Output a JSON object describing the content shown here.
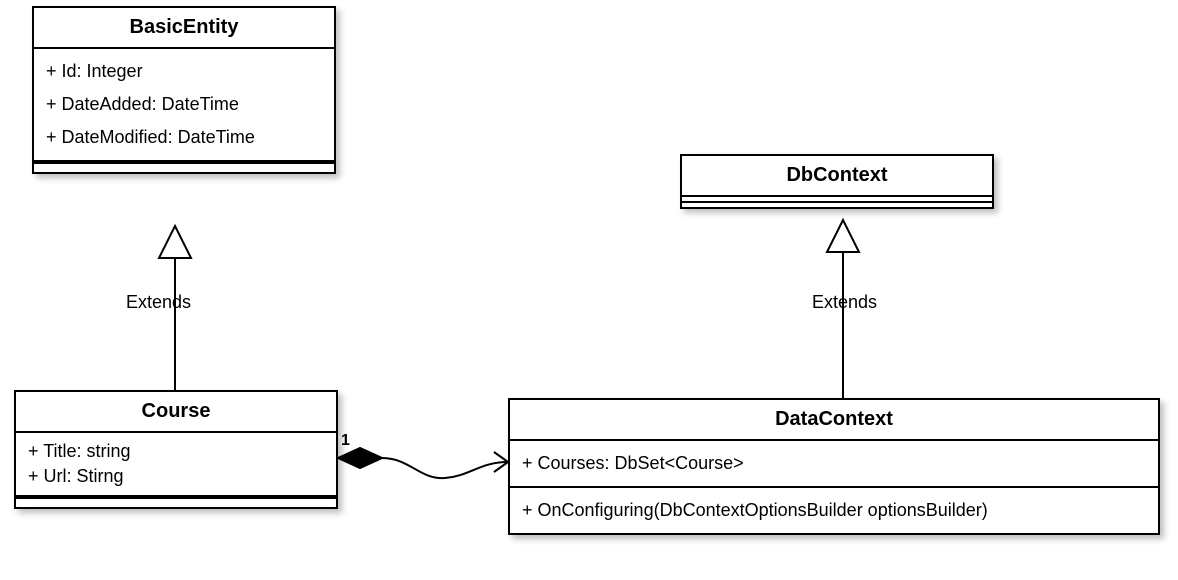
{
  "classes": {
    "basicEntity": {
      "name": "BasicEntity",
      "attrs": [
        "+ Id: Integer",
        "+ DateAdded: DateTime",
        "+ DateModified: DateTime"
      ]
    },
    "course": {
      "name": "Course",
      "attrs": [
        "+ Title: string",
        "+ Url: Stirng"
      ]
    },
    "dbContext": {
      "name": "DbContext"
    },
    "dataContext": {
      "name": "DataContext",
      "attrs": [
        "+ Courses: DbSet<Course>"
      ],
      "ops": [
        "+ OnConfiguring(DbContextOptionsBuilder optionsBuilder)"
      ]
    }
  },
  "relations": {
    "extends1": "Extends",
    "extends2": "Extends",
    "compositionMult": "1"
  }
}
